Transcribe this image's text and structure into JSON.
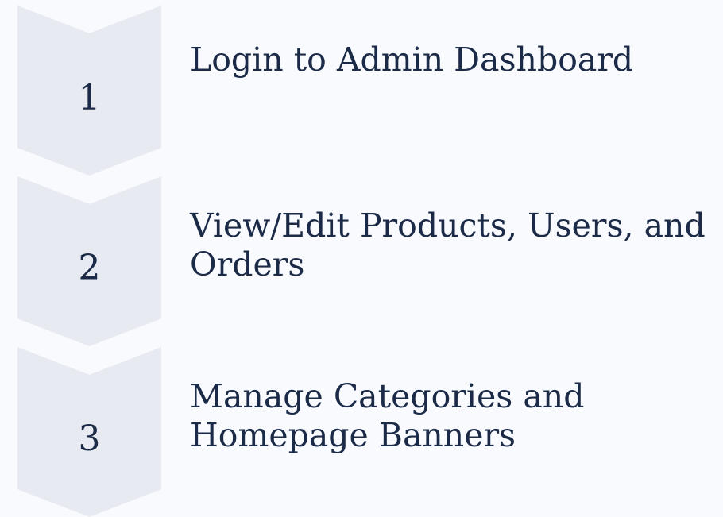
{
  "steps": [
    {
      "number": "1",
      "lines": [
        "Login to Admin Dashboard"
      ]
    },
    {
      "number": "2",
      "lines": [
        "View/Edit Products, Users, and",
        "Orders"
      ]
    },
    {
      "number": "3",
      "lines": [
        "Manage Categories and",
        "Homepage Banners"
      ]
    }
  ]
}
